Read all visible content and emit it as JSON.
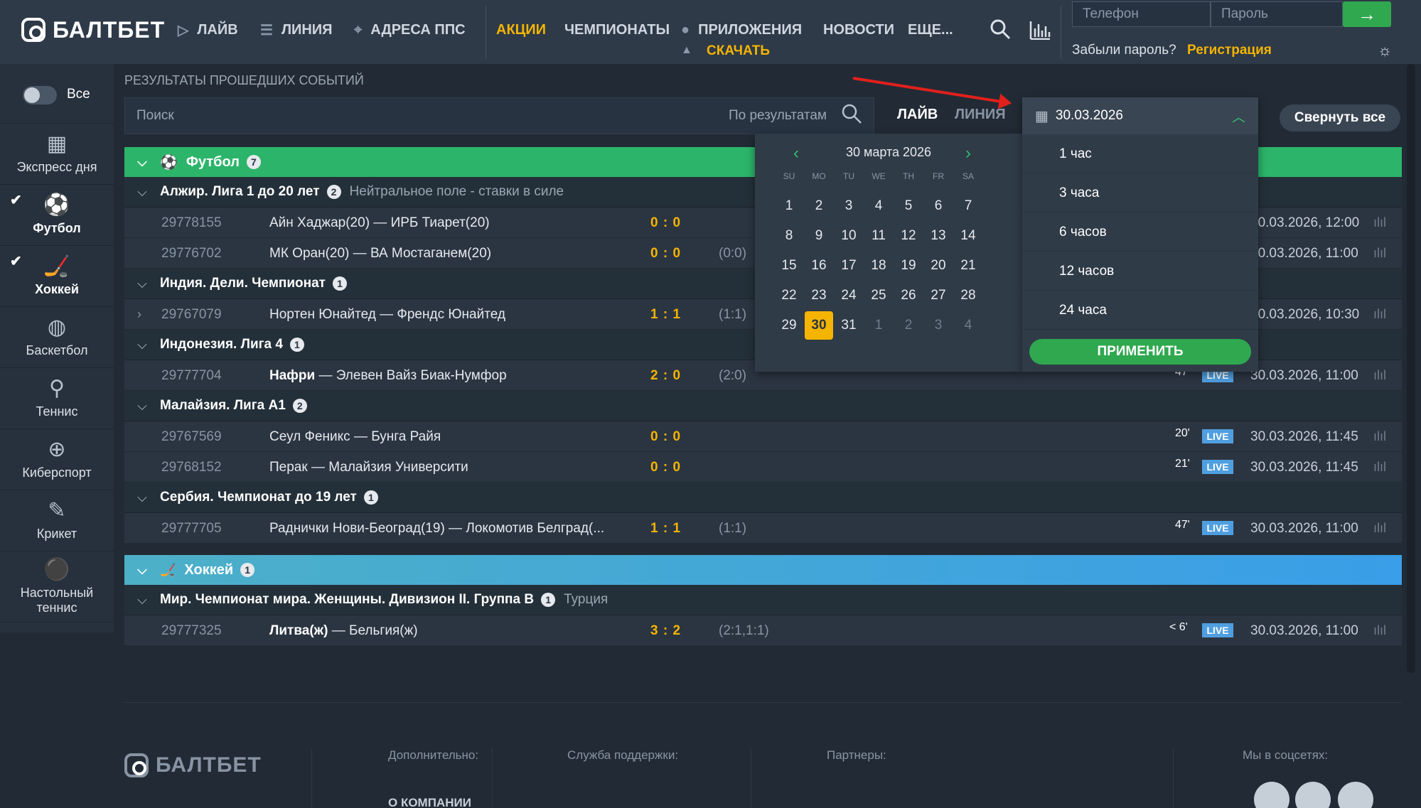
{
  "header": {
    "brand": "БАЛТБЕТ",
    "nav": [
      {
        "label": "ЛАЙВ",
        "icon": "play-icon"
      },
      {
        "label": "ЛИНИЯ",
        "icon": "list-icon"
      },
      {
        "label": "АДРЕСА ППС",
        "icon": "location-pin-icon"
      },
      {
        "label": "АКЦИИ"
      },
      {
        "label": "ЧЕМПИОНАТЫ"
      },
      {
        "label": "ПРИЛОЖЕНИЯ",
        "icon": "apple-icon"
      },
      {
        "label": "НОВОСТИ"
      },
      {
        "label": "ЕЩЕ..."
      }
    ],
    "download_label": "СКАЧАТЬ",
    "phone_placeholder": "Телефон",
    "password_placeholder": "Пароль",
    "forgot_password": "Забыли пароль?",
    "register": "Регистрация",
    "colors": {
      "accent": "#f5b400",
      "green": "#2fa84f",
      "live": "#4f9fe0",
      "hockey": "#3aa0e0"
    }
  },
  "sidebar": {
    "all_label": "Все",
    "items": [
      {
        "label": "Экспресс дня",
        "icon": "express-icon",
        "active": false
      },
      {
        "label": "Футбол",
        "icon": "soccer-ball-icon",
        "active": true
      },
      {
        "label": "Хоккей",
        "icon": "hockey-stick-icon",
        "active": true
      },
      {
        "label": "Баскетбол",
        "icon": "basketball-icon",
        "active": false
      },
      {
        "label": "Теннис",
        "icon": "tennis-racket-icon",
        "active": false
      },
      {
        "label": "Киберспорт",
        "icon": "esports-target-icon",
        "active": false
      },
      {
        "label": "Крикет",
        "icon": "cricket-bat-icon",
        "active": false
      },
      {
        "label": "Настольный теннис",
        "icon": "table-tennis-icon",
        "active": false
      }
    ]
  },
  "main": {
    "title": "РЕЗУЛЬТАТЫ ПРОШЕДШИХ СОБЫТИЙ",
    "search_placeholder": "Поиск",
    "search_scope": "По результатам",
    "tab_live": "ЛАЙВ",
    "tab_line": "ЛИНИЯ",
    "collapse_all": "Свернуть все"
  },
  "sports": [
    {
      "name": "Футбол",
      "count": "7",
      "leagues": [
        {
          "name": "Алжир. Лига 1 до 20 лет",
          "count": "2",
          "note": "Нейтральное поле - ставки в силе",
          "matches": [
            {
              "id": "29778155",
              "home": "Айн Хаджар(20)",
              "away": "ИРБ Тиарет(20)",
              "score": "0 : 0",
              "ht": "",
              "minute": "",
              "live": "",
              "date": "30.03.2026, 12:00"
            },
            {
              "id": "29776702",
              "home": "МК Оран(20)",
              "away": "ВА Мостаганем(20)",
              "score": "0 : 0",
              "ht": "(0:0)",
              "minute": "",
              "live": "",
              "date": "30.03.2026, 11:00"
            }
          ]
        },
        {
          "name": "Индия. Дели. Чемпионат",
          "count": "1",
          "note": "",
          "matches": [
            {
              "id": "29767079",
              "home": "Нортен Юнайтед",
              "away": "Френдс Юнайтед",
              "score": "1 : 1",
              "ht": "(1:1)",
              "minute": "",
              "live": "",
              "date": "30.03.2026, 10:30"
            }
          ]
        },
        {
          "name": "Индонезия. Лига 4",
          "count": "1",
          "note": "",
          "matches": [
            {
              "id": "29777704",
              "home": "Нафри",
              "away": "Элевен Вайз Биак-Нумфор",
              "score": "2 : 0",
              "ht": "(2:0)",
              "minute": "47'",
              "live": "LIVE",
              "date": "30.03.2026, 11:00"
            }
          ]
        },
        {
          "name": "Малайзия. Лига А1",
          "count": "2",
          "note": "",
          "matches": [
            {
              "id": "29767569",
              "home": "Сеул Феникс",
              "away": "Бунга Райя",
              "score": "0 : 0",
              "ht": "",
              "minute": "20'",
              "live": "LIVE",
              "date": "30.03.2026, 11:45"
            },
            {
              "id": "29768152",
              "home": "Перак",
              "away": "Малайзия Университи",
              "score": "0 : 0",
              "ht": "",
              "minute": "21'",
              "live": "LIVE",
              "date": "30.03.2026, 11:45"
            }
          ]
        },
        {
          "name": "Сербия. Чемпионат до 19 лет",
          "count": "1",
          "note": "",
          "matches": [
            {
              "id": "29777705",
              "home": "Раднички Нови-Београд(19)",
              "away": "Локомотив Белград(...",
              "score": "1 : 1",
              "ht": "(1:1)",
              "minute": "47'",
              "live": "LIVE",
              "date": "30.03.2026, 11:00"
            }
          ]
        }
      ]
    },
    {
      "name": "Хоккей",
      "count": "1",
      "leagues": [
        {
          "name": "Мир. Чемпионат мира. Женщины. Дивизион II. Группа В",
          "count": "1",
          "note": "Турция",
          "matches": [
            {
              "id": "29777325",
              "home": "Литва(ж)",
              "away": "Бельгия(ж)",
              "score": "3 : 2",
              "ht": "(2:1,1:1)",
              "minute": "< 6'",
              "live": "LIVE",
              "date": "30.03.2026, 11:00"
            }
          ]
        }
      ]
    }
  ],
  "calendar": {
    "month_label": "30 марта 2026",
    "weekdays": [
      "SU",
      "MO",
      "TU",
      "WE",
      "TH",
      "FR",
      "SA"
    ],
    "weeks": [
      [
        "1",
        "2",
        "3",
        "4",
        "5",
        "6",
        "7"
      ],
      [
        "8",
        "9",
        "10",
        "11",
        "12",
        "13",
        "14"
      ],
      [
        "15",
        "16",
        "17",
        "18",
        "19",
        "20",
        "21"
      ],
      [
        "22",
        "23",
        "24",
        "25",
        "26",
        "27",
        "28"
      ],
      [
        "29",
        "30",
        "31",
        "1",
        "2",
        "3",
        "4"
      ]
    ],
    "selected_day": "30"
  },
  "date_dropdown": {
    "value": "30.03.2026",
    "options": [
      "1 час",
      "3 часа",
      "6 часов",
      "12 часов",
      "24 часа"
    ],
    "apply": "ПРИМЕНИТЬ"
  },
  "footer": {
    "brand": "БАЛТБЕТ",
    "extra": "Дополнительно:",
    "company": "О КОМПАНИИ",
    "support": "Служба поддержки:",
    "partners": "Партнеры:",
    "socials": "Мы в соцсетях:"
  }
}
